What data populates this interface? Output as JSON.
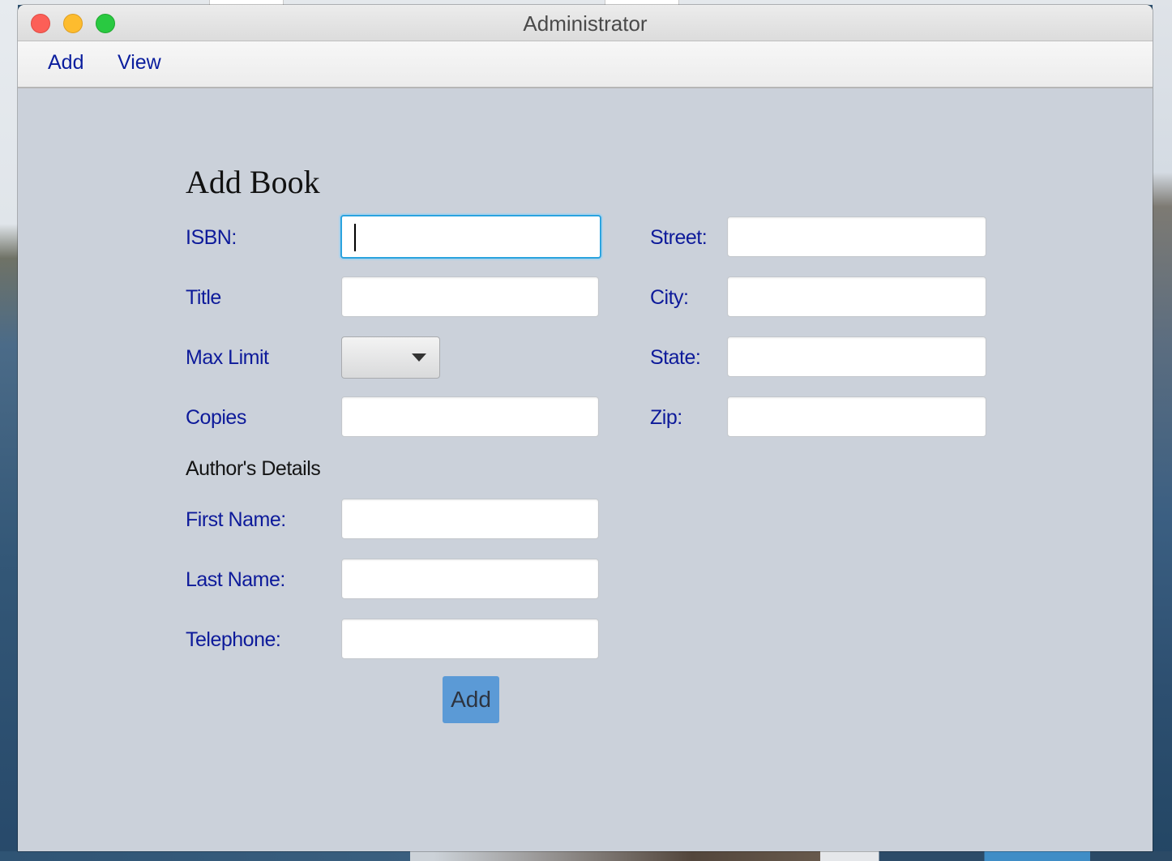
{
  "window": {
    "title": "Administrator"
  },
  "menu": {
    "items": [
      "Add",
      "View"
    ]
  },
  "form": {
    "heading": "Add Book",
    "isbn_label": "ISBN:",
    "title_label": "Title",
    "max_limit_label": "Max Limit",
    "copies_label": "Copies",
    "author_section": "Author's Details",
    "first_name_label": "First Name:",
    "last_name_label": "Last Name:",
    "telephone_label": "Telephone:",
    "street_label": "Street:",
    "city_label": "City:",
    "state_label": "State:",
    "zip_label": "Zip:",
    "max_limit_value": "",
    "values": {
      "isbn": "",
      "title": "",
      "copies": "",
      "first_name": "",
      "last_name": "",
      "telephone": "",
      "street": "",
      "city": "",
      "state": "",
      "zip": ""
    },
    "submit_label": "Add"
  },
  "colors": {
    "label": "#0d1a9a",
    "window_bg": "#cbd1da",
    "button": "#5b9ad6",
    "focus_ring": "#2aa3df"
  }
}
